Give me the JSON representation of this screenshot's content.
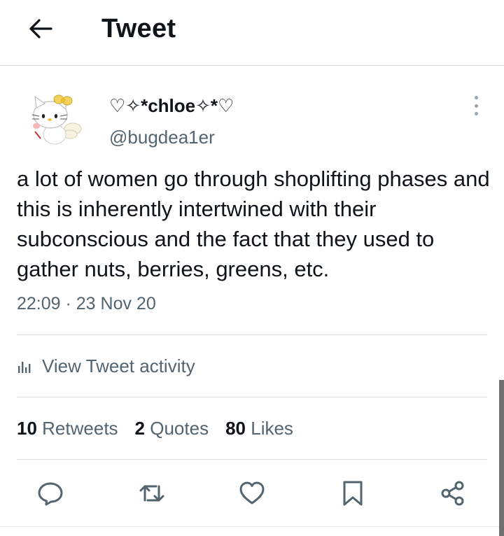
{
  "header": {
    "title": "Tweet",
    "back_icon": "arrow-left-icon"
  },
  "author": {
    "display_name": "♡✧*chloe✧*♡",
    "handle": "@bugdea1er",
    "avatar": "hello-kitty-avatar"
  },
  "tweet": {
    "text": "a lot of women go through shoplifting phases and this is inherently intertwined with their subconscious and the fact that they used to gather nuts, berries, greens, etc.",
    "timestamp": "22:09 · 23 Nov 20"
  },
  "activity": {
    "label": "View Tweet activity",
    "icon": "bar-chart-icon"
  },
  "stats": {
    "retweets_count": "10",
    "retweets_label": "Retweets",
    "quotes_count": "2",
    "quotes_label": "Quotes",
    "likes_count": "80",
    "likes_label": "Likes"
  },
  "actions": [
    "reply-icon",
    "retweet-icon",
    "like-icon",
    "bookmark-icon",
    "share-icon"
  ],
  "colors": {
    "text_primary": "#0f1419",
    "text_secondary": "#536471",
    "divider": "#dcdfe2"
  }
}
